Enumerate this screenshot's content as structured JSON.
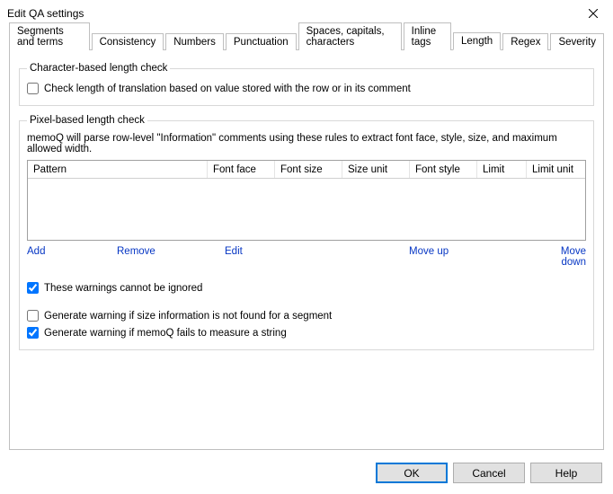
{
  "window": {
    "title": "Edit QA settings"
  },
  "tabs": [
    {
      "label": "Segments and terms"
    },
    {
      "label": "Consistency"
    },
    {
      "label": "Numbers"
    },
    {
      "label": "Punctuation"
    },
    {
      "label": "Spaces, capitals, characters"
    },
    {
      "label": "Inline tags"
    },
    {
      "label": "Length"
    },
    {
      "label": "Regex"
    },
    {
      "label": "Severity"
    }
  ],
  "group_char": {
    "legend": "Character-based length check",
    "chk_label": "Check length of translation based on value stored with the row or in its comment"
  },
  "group_pixel": {
    "legend": "Pixel-based length check",
    "desc": "memoQ will parse row-level \"Information\" comments using these rules to extract font face, style, size, and maximum allowed width.",
    "cols": {
      "pattern": "Pattern",
      "fontface": "Font face",
      "fontsize": "Font size",
      "sizeunit": "Size unit",
      "fontstyle": "Font style",
      "limit": "Limit",
      "limitunit": "Limit unit"
    },
    "actions": {
      "add": "Add",
      "remove": "Remove",
      "edit": "Edit",
      "moveup": "Move up",
      "movedown": "Move down"
    },
    "chk_cannot_ignore": "These warnings cannot be ignored",
    "chk_size_not_found": "Generate warning if size information is not found for a segment",
    "chk_fail_measure": "Generate warning if memoQ fails to measure a string"
  },
  "buttons": {
    "ok": "OK",
    "cancel": "Cancel",
    "help": "Help"
  }
}
